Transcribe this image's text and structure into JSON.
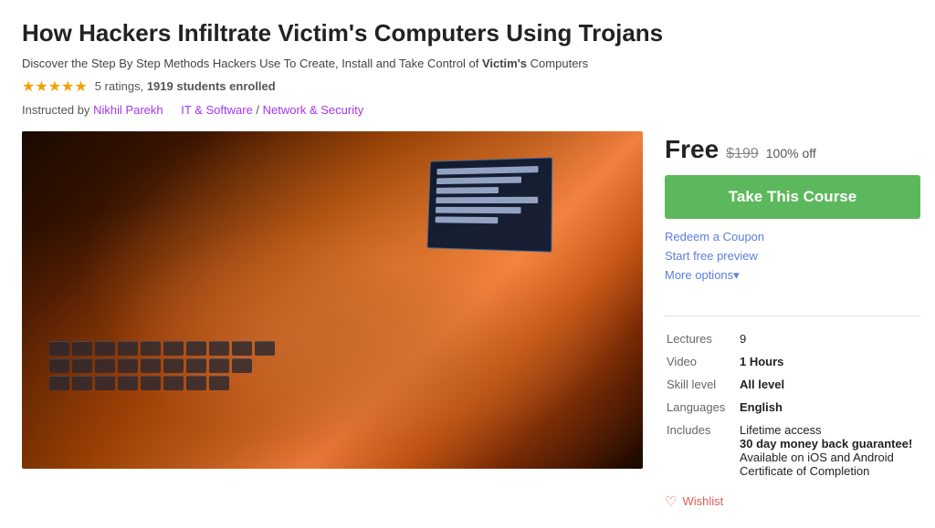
{
  "page": {
    "title": "How Hackers Infiltrate Victim's Computers Using Trojans",
    "subtitle_prefix": "Discover the Step By Step Methods Hackers Use To Create, Install",
    "subtitle_and": "and",
    "subtitle_suffix": "Take Control of",
    "subtitle_bold": "Victim's",
    "subtitle_end": "Computers",
    "ratings": {
      "stars": "★★★★★",
      "count": "5 ratings,",
      "students": "1919 students enrolled"
    },
    "instructors": {
      "label": "Instructed by",
      "name": "Nikhil Parekh",
      "separator": "IT & Software",
      "category": "Network & Security"
    },
    "image": {
      "alt": "Hacker typing on keyboard"
    },
    "sidebar": {
      "price_free": "Free",
      "price_original": "$199",
      "price_discount": "100% off",
      "take_course_btn": "Take This Course",
      "redeem_link": "Redeem a Coupon",
      "preview_link": "Start free preview",
      "more_options_link": "More options",
      "more_options_arrow": "▾",
      "info": {
        "lectures_label": "Lectures",
        "lectures_value": "9",
        "video_label": "Video",
        "video_value": "1 Hours",
        "skill_label": "Skill level",
        "skill_value": "All level",
        "languages_label": "Languages",
        "languages_value": "English",
        "includes_label": "Includes",
        "includes_line1": "Lifetime access",
        "includes_line2": "30 day money back guarantee!",
        "includes_line3": "Available on iOS and Android",
        "includes_line4": "Certificate of Completion"
      },
      "wishlist": "Wishlist"
    }
  }
}
